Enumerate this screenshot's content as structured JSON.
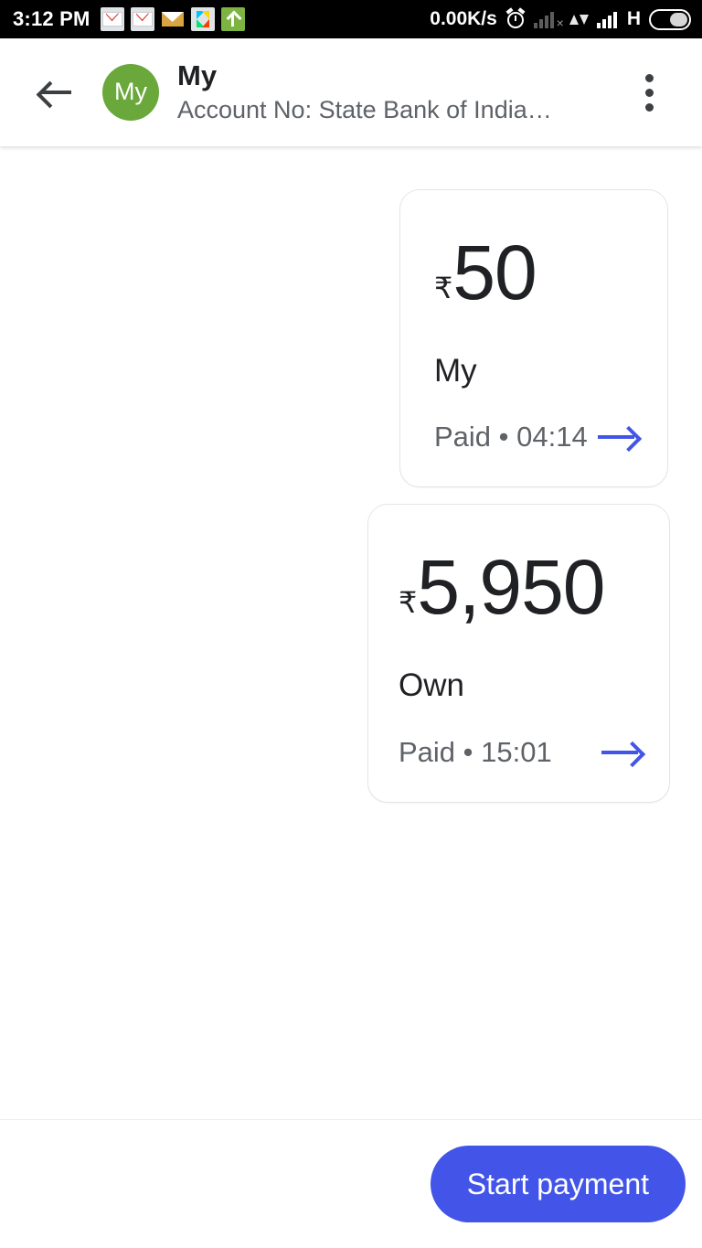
{
  "status_bar": {
    "clock": "3:12 PM",
    "network_speed": "0.00K/s",
    "network_type": "H",
    "left_icons": [
      "gmail-icon",
      "gmail-icon",
      "mail-icon",
      "play-store-icon",
      "upload-icon"
    ],
    "right_icons": [
      "alarm-icon",
      "signal-no-service-icon",
      "data-transfer-icon",
      "signal-bars-icon",
      "battery-icon"
    ]
  },
  "app_bar": {
    "back_icon": "back-arrow-icon",
    "avatar_initials": "My",
    "avatar_color": "#6aa83c",
    "title": "My",
    "subtitle": "Account No: State Bank of India…",
    "overflow_icon": "more-vert-icon"
  },
  "bubbles": [
    {
      "currency": "₹",
      "amount": "50",
      "name": "My",
      "status": "Paid • 04:14",
      "arrow_icon": "arrow-forward-icon"
    },
    {
      "currency": "₹",
      "amount": "5,950",
      "name": "Own",
      "status": "Paid • 15:01",
      "arrow_icon": "arrow-forward-icon"
    }
  ],
  "bottom_bar": {
    "start_payment_label": "Start payment"
  },
  "colors": {
    "accent": "#4355e8",
    "avatar": "#6aa83c",
    "text_primary": "#202124",
    "text_secondary": "#5f6368"
  }
}
